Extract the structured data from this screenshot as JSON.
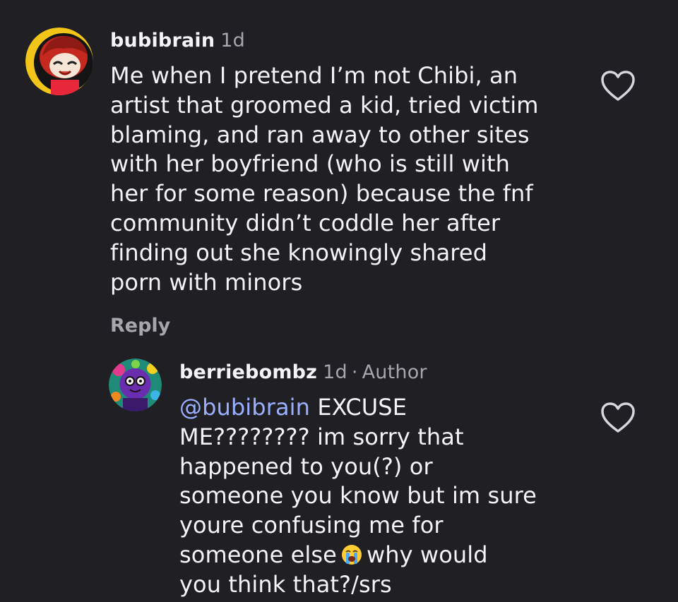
{
  "comments": [
    {
      "username": "bubibrain",
      "time": "1d",
      "lines": [
        "Me when I pretend I’m not Chibi, an",
        "artist that groomed a kid, tried victim",
        "blaming, and ran away to other sites",
        "with her boyfriend (who is still with",
        "her for some reason) because the fnf",
        "community didn’t coddle her after",
        "finding out she knowingly shared",
        "porn with minors"
      ],
      "reply_label": "Reply",
      "like_icon": "heart-outline-icon"
    },
    {
      "username": "berriebombz",
      "time": "1d",
      "meta_sep": "·",
      "badge": "Author",
      "mention": "@bubibrain",
      "line1_rest": "EXCUSE",
      "lines": [
        "ME???????? im sorry that",
        "happened to you(?) or",
        "someone you know but im sure",
        "youre confusing me for"
      ],
      "line6_start": "someone else",
      "emoji": "loudly-crying-face-emoji",
      "line6_end": "why would",
      "line7": "you think that?/srs",
      "like_icon": "heart-outline-icon"
    }
  ]
}
